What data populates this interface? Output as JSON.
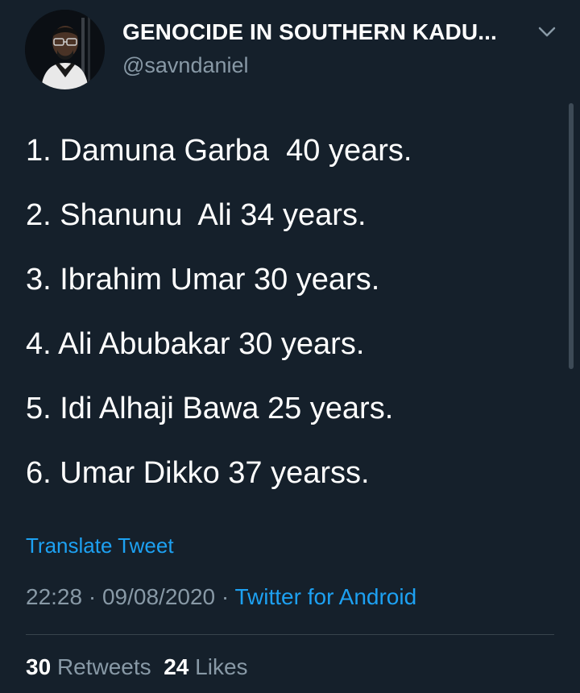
{
  "author": {
    "display_name": "GENOCIDE IN SOUTHERN KADU...",
    "handle": "@savndaniel",
    "avatar_icon": "person-avatar"
  },
  "tweet": {
    "lines": [
      "1. Damuna Garba  40 years.",
      "2. Shanunu  Ali 34 years.",
      "3. Ibrahim Umar 30 years.",
      "4. Ali Abubakar 30 years.",
      "5. Idi Alhaji Bawa 25 years.",
      "6. Umar Dikko 37 yearss."
    ],
    "translate_label": "Translate Tweet",
    "time": "22:28",
    "separator": "·",
    "date": "09/08/2020",
    "source": "Twitter for Android"
  },
  "stats": {
    "retweets_count": "30",
    "retweets_label": "Retweets",
    "likes_count": "24",
    "likes_label": "Likes"
  },
  "colors": {
    "background": "#15202b",
    "accent": "#1da1f2",
    "muted": "#8899a6"
  }
}
